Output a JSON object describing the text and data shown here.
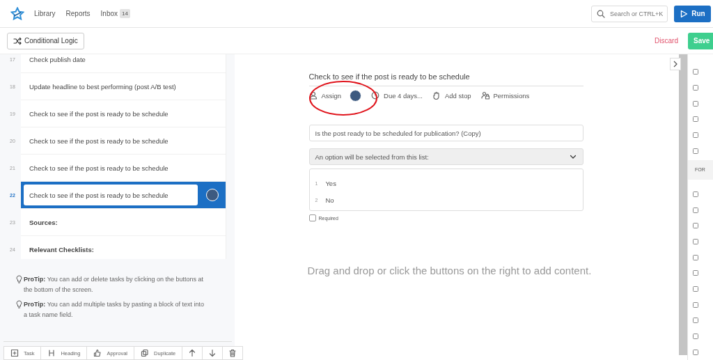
{
  "nav": {
    "links": [
      {
        "label": "Library"
      },
      {
        "label": "Reports"
      },
      {
        "label": "Inbox",
        "badge": "14"
      }
    ],
    "search": {
      "placeholder": "Search or CTRL+K"
    },
    "run_button": "Run"
  },
  "toolbar": {
    "conditional_logic": "Conditional Logic",
    "discard": "Discard",
    "save": "Save"
  },
  "tasks": [
    {
      "number": "17",
      "label": "Check publish date",
      "kind": "task",
      "selected": false
    },
    {
      "number": "18",
      "label": "Update headline to best performing (post A/B test)",
      "kind": "task",
      "selected": false
    },
    {
      "number": "19",
      "label": "Check to see if the post is ready to be schedule",
      "kind": "task",
      "selected": false
    },
    {
      "number": "20",
      "label": "Check to see if the post is ready to be schedule",
      "kind": "task",
      "selected": false
    },
    {
      "number": "21",
      "label": "Check to see if the post is ready to be schedule",
      "kind": "task",
      "selected": false
    },
    {
      "number": "22",
      "label": "Check to see if the post is ready to be schedule",
      "kind": "task",
      "selected": true
    },
    {
      "number": "23",
      "label": "Sources:",
      "kind": "heading",
      "selected": false
    },
    {
      "number": "24",
      "label": "Relevant Checklists:",
      "kind": "heading",
      "selected": false
    }
  ],
  "tips": [
    "**ProTip:** You can add or delete tasks by clicking on the buttons at the bottom of the screen.",
    "**ProTip:** You can add multiple tasks by pasting a block of text into a task name field."
  ],
  "task_toolbar": [
    {
      "kind": "task",
      "label": "Task"
    },
    {
      "kind": "heading",
      "label": "Heading"
    },
    {
      "kind": "approval",
      "label": "Approval"
    },
    {
      "kind": "duplicate",
      "label": "Duplicate"
    },
    {
      "kind": "up"
    },
    {
      "kind": "down"
    },
    {
      "kind": "delete"
    }
  ],
  "editor": {
    "title": "Check to see if the post is ready to be schedule",
    "actions": [
      {
        "kind": "assign",
        "label": "Assign"
      },
      {
        "kind": "due",
        "label": "Due 4 days..."
      },
      {
        "kind": "stop",
        "label": "Add stop"
      },
      {
        "kind": "permissions",
        "label": "Permissions"
      }
    ],
    "question": "Is the post ready to be scheduled for publication? (Copy)",
    "dropdown": "An option will be selected from this list:",
    "options": [
      {
        "number": "1",
        "label": "Yes"
      },
      {
        "number": "2",
        "label": "No"
      }
    ],
    "required": {
      "label": "Required",
      "checked": false
    },
    "empty_hint": "Drag and drop or click the buttons on the right to add content."
  },
  "right_sidebar": {
    "section_label": "FOR"
  }
}
